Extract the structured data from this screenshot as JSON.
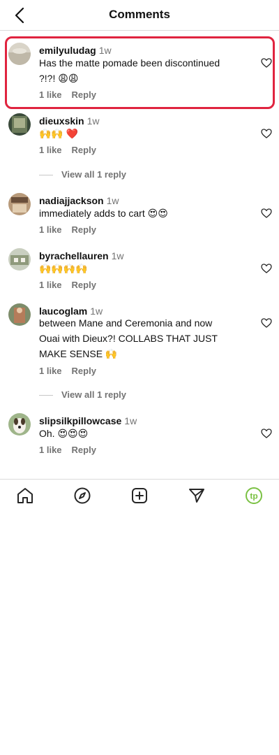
{
  "header": {
    "title": "Comments"
  },
  "comments": [
    {
      "user": "emilyuludag",
      "time": "1w",
      "text_lines": [
        "Has the matte pomade been discontinued",
        "?!?! 😩😩"
      ],
      "likes": "1 like",
      "reply": "Reply"
    },
    {
      "user": "dieuxskin",
      "time": "1w",
      "text_lines": [
        "🙌🙌 ❤️"
      ],
      "likes": "1 like",
      "reply": "Reply",
      "view_replies": "View all 1 reply"
    },
    {
      "user": "nadiajjackson",
      "time": "1w",
      "text_lines": [
        "immediately adds to cart 😍😍"
      ],
      "likes": "1 like",
      "reply": "Reply"
    },
    {
      "user": "byrachellauren",
      "time": "1w",
      "text_lines": [
        "🙌🙌🙌🙌"
      ],
      "likes": "1 like",
      "reply": "Reply"
    },
    {
      "user": "laucoglam",
      "time": "1w",
      "text_lines": [
        "between Mane and Ceremonia and now",
        "Ouai with Dieux?! COLLABS THAT JUST",
        "MAKE SENSE 🙌"
      ],
      "likes": "1 like",
      "reply": "Reply",
      "view_replies": "View all 1 reply"
    },
    {
      "user": "slipsilkpillowcase",
      "time": "1w",
      "text_lines": [
        "Oh. 😍😍😍"
      ],
      "likes": "1 like",
      "reply": "Reply"
    }
  ],
  "tabbar": {
    "icons": [
      "home-icon",
      "explore-icon",
      "create-icon",
      "direct-icon",
      "profile-icon"
    ],
    "profile_initials": "tp",
    "profile_color": "#7ac143"
  }
}
